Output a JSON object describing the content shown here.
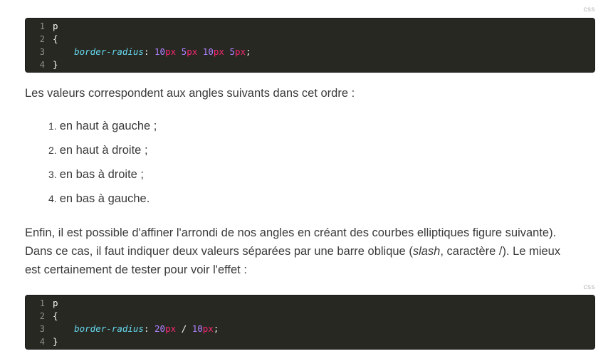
{
  "code_blocks": [
    {
      "lang": "css",
      "lines": [
        {
          "n": "1",
          "tokens": [
            {
              "t": "p",
              "c": "src"
            }
          ]
        },
        {
          "n": "2",
          "tokens": [
            {
              "t": "{",
              "c": "src"
            }
          ]
        },
        {
          "n": "3",
          "tokens": [
            {
              "t": "    ",
              "c": "src"
            },
            {
              "t": "border-radius",
              "c": "prop"
            },
            {
              "t": ": ",
              "c": "punct"
            },
            {
              "t": "10",
              "c": "num"
            },
            {
              "t": "px",
              "c": "unit"
            },
            {
              "t": " ",
              "c": "src"
            },
            {
              "t": "5",
              "c": "num"
            },
            {
              "t": "px",
              "c": "unit"
            },
            {
              "t": " ",
              "c": "src"
            },
            {
              "t": "10",
              "c": "num"
            },
            {
              "t": "px",
              "c": "unit"
            },
            {
              "t": " ",
              "c": "src"
            },
            {
              "t": "5",
              "c": "num"
            },
            {
              "t": "px",
              "c": "unit"
            },
            {
              "t": ";",
              "c": "punct"
            }
          ]
        },
        {
          "n": "4",
          "tokens": [
            {
              "t": "}",
              "c": "src"
            }
          ]
        }
      ]
    },
    {
      "lang": "css",
      "lines": [
        {
          "n": "1",
          "tokens": [
            {
              "t": "p",
              "c": "src"
            }
          ]
        },
        {
          "n": "2",
          "tokens": [
            {
              "t": "{",
              "c": "src"
            }
          ]
        },
        {
          "n": "3",
          "tokens": [
            {
              "t": "    ",
              "c": "src"
            },
            {
              "t": "border-radius",
              "c": "prop"
            },
            {
              "t": ": ",
              "c": "punct"
            },
            {
              "t": "20",
              "c": "num"
            },
            {
              "t": "px",
              "c": "unit"
            },
            {
              "t": " / ",
              "c": "punct"
            },
            {
              "t": "10",
              "c": "num"
            },
            {
              "t": "px",
              "c": "unit"
            },
            {
              "t": ";",
              "c": "punct"
            }
          ]
        },
        {
          "n": "4",
          "tokens": [
            {
              "t": "}",
              "c": "src"
            }
          ]
        }
      ]
    }
  ],
  "intro": "Les valeurs correspondent aux angles suivants dans cet ordre :",
  "corners": [
    {
      "num": "1.",
      "text": "en haut à gauche ;"
    },
    {
      "num": "2.",
      "text": "en haut à droite ;"
    },
    {
      "num": "3.",
      "text": "en bas à droite ;"
    },
    {
      "num": "4.",
      "text": "en bas à gauche."
    }
  ],
  "outro": {
    "line1": "Enfin, il est possible d'affiner l'arrondi de nos angles en créant des courbes elliptiques figure suivante).",
    "line2_before": "Dans ce cas, il faut indiquer deux valeurs séparées par une barre oblique (",
    "line2_em": "slash",
    "line2_after": ", caractère /). Le mieux",
    "line3": "est certainement de tester pour voir l'effet :"
  },
  "colors": {
    "code_bg": "#272822",
    "code_text": "#f8f8f2",
    "property": "#66d9ef",
    "number": "#ae81ff",
    "unit": "#f92672",
    "line_number": "#8f908a",
    "body_text": "#3a3a3a",
    "lang_tag": "#b8b8b8"
  }
}
